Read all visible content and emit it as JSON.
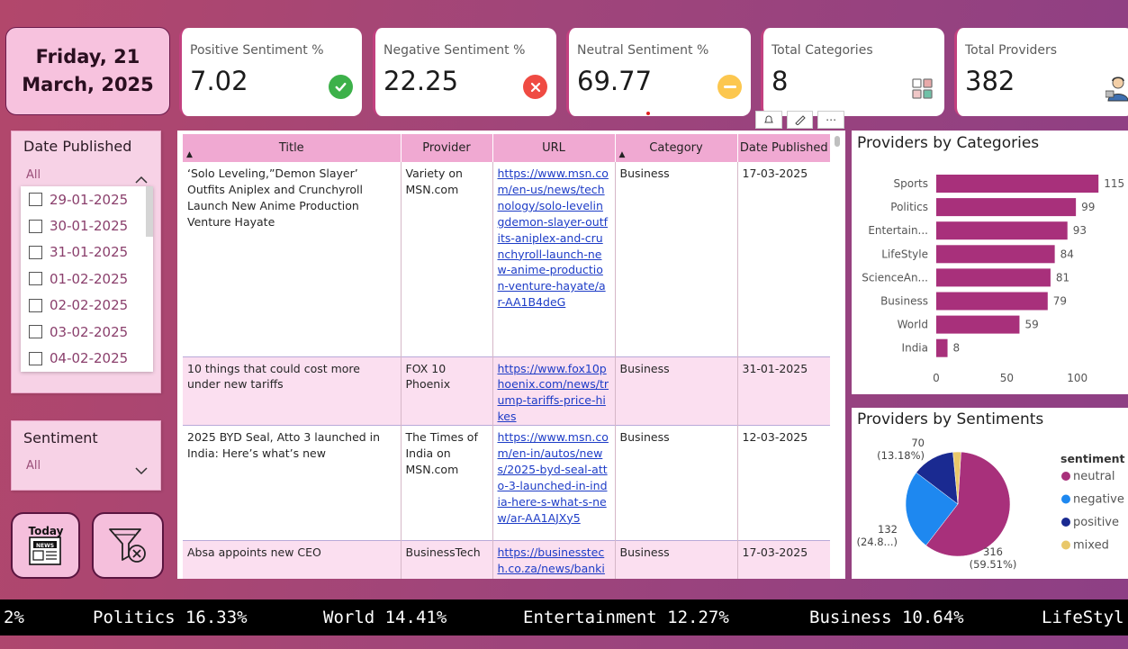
{
  "date_card": {
    "line1": "Friday, 21",
    "line2": "March, 2025"
  },
  "kpis": [
    {
      "label": "Positive Sentiment %",
      "value": "7.02",
      "icon": "check-circle-icon",
      "color": "#3db14a"
    },
    {
      "label": "Negative Sentiment %",
      "value": "22.25",
      "icon": "x-circle-icon",
      "color": "#ef4b43"
    },
    {
      "label": "Neutral Sentiment %",
      "value": "69.77",
      "icon": "minus-circle-icon",
      "color": "#fcc74f"
    },
    {
      "label": "Total Categories",
      "value": "8",
      "icon": "categories-grid-icon"
    },
    {
      "label": "Total Providers",
      "value": "382",
      "icon": "provider-person-icon"
    }
  ],
  "date_slicer": {
    "title": "Date Published",
    "selected": "All",
    "options": [
      "29-01-2025",
      "30-01-2025",
      "31-01-2025",
      "01-02-2025",
      "02-02-2025",
      "03-02-2025",
      "04-02-2025"
    ]
  },
  "sentiment_slicer": {
    "title": "Sentiment",
    "selected": "All"
  },
  "buttons": {
    "today_label": "Today",
    "news_label": "NEWS"
  },
  "table": {
    "headers": [
      "Title",
      "Provider",
      "URL",
      "Category",
      "Date Published"
    ],
    "rows": [
      {
        "title": "‘Solo Leveling,”Demon Slayer’ Outfits Aniplex and Crunchyroll Launch New Anime Production Venture Hayate",
        "provider": "Variety on MSN.com",
        "url": "https://www.msn.com/en-us/news/technology/solo-levelingdemon-slayer-outfits-aniplex-and-crunchyroll-launch-new-anime-production-venture-hayate/ar-AA1B4deG",
        "category": "Business",
        "date": "17-03-2025"
      },
      {
        "title": "10 things that could cost more under new tariffs",
        "provider": "FOX 10 Phoenix",
        "url": "https://www.fox10phoenix.com/news/trump-tariffs-price-hikes",
        "category": "Business",
        "date": "31-01-2025"
      },
      {
        "title": "2025 BYD Seal, Atto 3 launched in India: Here’s what’s new",
        "provider": "The Times of India on MSN.com",
        "url": "https://www.msn.com/en-in/autos/news/2025-byd-seal-atto-3-launched-in-india-here-s-what-s-new/ar-AA1AJXy5",
        "category": "Business",
        "date": "12-03-2025"
      },
      {
        "title": "Absa appoints new CEO",
        "provider": "BusinessTech",
        "url": "https://businesstech.co.za/news/banking",
        "category": "Business",
        "date": "17-03-2025"
      }
    ]
  },
  "chart_data": [
    {
      "type": "bar",
      "title": "Providers by Categories",
      "categories": [
        "Sports",
        "Politics",
        "Entertain...",
        "LifeStyle",
        "ScienceAn...",
        "Business",
        "World",
        "India"
      ],
      "values": [
        115,
        99,
        93,
        84,
        81,
        79,
        59,
        8
      ],
      "xticks": [
        "0",
        "50",
        "100"
      ],
      "xlim": [
        0,
        115
      ],
      "color": "#a8307b"
    },
    {
      "type": "pie",
      "title": "Providers by Sentiments",
      "legend_title": "sentiment",
      "slices": [
        {
          "name": "neutral",
          "value": 316,
          "label": "316",
          "pct": "(59.51%)",
          "color": "#a8307b"
        },
        {
          "name": "negative",
          "value": 132,
          "label": "132",
          "pct": "(24.8...)",
          "color": "#1e88f0"
        },
        {
          "name": "positive",
          "value": 70,
          "label": "70",
          "pct": "(13.18%)",
          "color": "#1a2a91"
        },
        {
          "name": "mixed",
          "value": 13,
          "label": "",
          "pct": "",
          "color": "#e9c86a"
        }
      ]
    }
  ],
  "ticker": [
    "2%",
    "Politics 16.33%",
    "World 14.41%",
    "Entertainment 12.27%",
    "Business 10.64%",
    "LifeStyl"
  ]
}
